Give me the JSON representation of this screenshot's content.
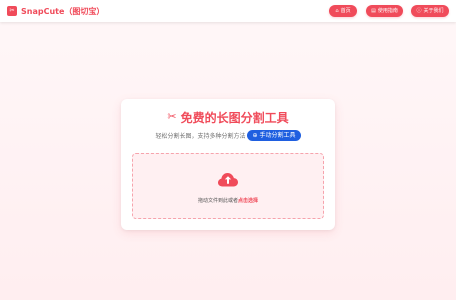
{
  "header": {
    "logo_icon": "scissors-icon",
    "brand": "SnapCute（图切宝）",
    "nav": [
      {
        "label": "首页",
        "icon": "home-icon"
      },
      {
        "label": "使用指南",
        "icon": "book-icon"
      },
      {
        "label": "关于我们",
        "icon": "info-icon"
      }
    ]
  },
  "main": {
    "title_icon": "scissors-icon",
    "title": "免费的长图分割工具",
    "subtitle": "轻松分割长图，支持多种分割方法",
    "manual_tool": {
      "label": "手动分割工具",
      "icon": "plus-circle-icon"
    },
    "dropzone": {
      "icon": "cloud-upload-icon",
      "text": "拖动文件到此或者",
      "link": "点击选择"
    }
  },
  "colors": {
    "accent": "#f04b5a",
    "secondary": "#1f5fe0",
    "background": "#fff5f6"
  }
}
